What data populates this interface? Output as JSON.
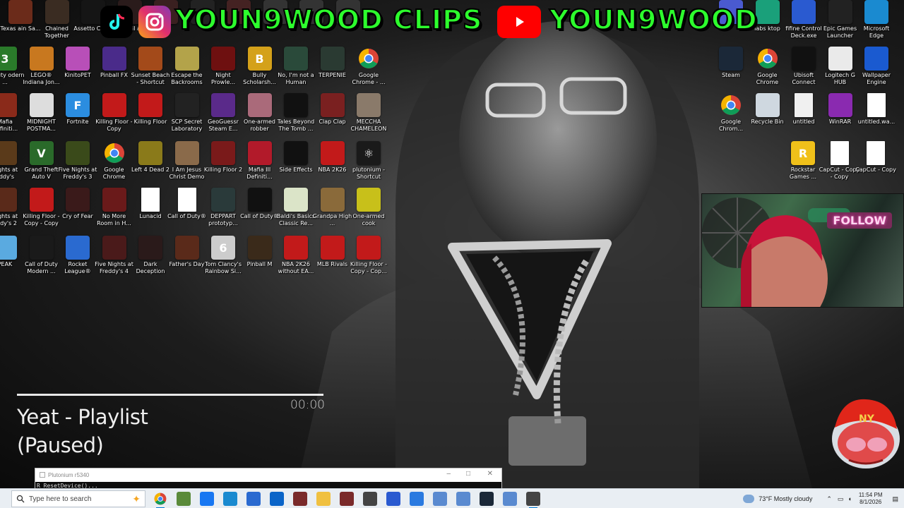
{
  "banner": {
    "text_left": "YOUN9WOOD CLIPS",
    "text_right": "YOUN9WOOD",
    "colors": {
      "text": "#2dff2d",
      "instagram": "#e1306c",
      "youtube": "#ff0000",
      "tiktok": "#000000"
    }
  },
  "desktop_left": [
    [
      {
        "label": "Texas\nain Sa...",
        "icon": "game-icon",
        "color": "#6b2b1a",
        "glyph": ""
      },
      {
        "label": "Chained Together",
        "icon": "game-icon",
        "color": "#3a2c22",
        "glyph": ""
      },
      {
        "label": "Assetto Corsa",
        "icon": "racing-icon",
        "color": "#151515",
        "glyph": ""
      },
      {
        "label": "ead Evil ard",
        "icon": "game-icon",
        "color": "#2a1b1b",
        "glyph": ""
      },
      {
        "label": "",
        "icon": "game-icon",
        "color": "#3a2020",
        "glyph": ""
      },
      {
        "label": "",
        "icon": "game-icon",
        "color": "#222",
        "glyph": ""
      },
      {
        "label": "",
        "icon": "game-icon",
        "color": "#442222",
        "glyph": ""
      },
      {
        "label": "",
        "icon": "game-icon",
        "color": "#333",
        "glyph": ""
      },
      {
        "label": "",
        "icon": "game-icon",
        "color": "#333",
        "glyph": ""
      },
      {
        "label": "",
        "icon": "game-icon",
        "color": "#333",
        "glyph": ""
      }
    ],
    [
      {
        "label": "of Duty odern ...",
        "icon": "game-icon",
        "color": "#2a7a2a",
        "glyph": "3"
      },
      {
        "label": "LEGO® Indiana Jon...",
        "icon": "game-icon",
        "color": "#c8781f",
        "glyph": ""
      },
      {
        "label": "KinitoPET",
        "icon": "pet-icon",
        "color": "#b84fb8",
        "glyph": ""
      },
      {
        "label": "Pinball FX",
        "icon": "pinball-icon",
        "color": "#4a2b8a",
        "glyph": ""
      },
      {
        "label": "Sunset Beach - Shortcut",
        "icon": "game-icon",
        "color": "#a34a1a",
        "glyph": ""
      },
      {
        "label": "Escape the Backrooms",
        "icon": "game-icon",
        "color": "#b3a34a",
        "glyph": ""
      },
      {
        "label": "Night Prowle...",
        "icon": "game-icon",
        "color": "#6e1010",
        "glyph": ""
      },
      {
        "label": "Bully Scholarsh...",
        "icon": "game-icon",
        "color": "#d4a11a",
        "glyph": "B"
      },
      {
        "label": "No, I'm not a Human",
        "icon": "game-icon",
        "color": "#2a4a3a",
        "glyph": ""
      },
      {
        "label": "TERPENIE",
        "icon": "game-icon",
        "color": "#2a3a32",
        "glyph": ""
      },
      {
        "label": "Google Chrome - ...",
        "icon": "chrome-icon",
        "color": "chrome",
        "glyph": ""
      }
    ],
    [
      {
        "label": "Mafia Definiti...",
        "icon": "game-icon",
        "color": "#8a2a1a",
        "glyph": ""
      },
      {
        "label": "MIDNIGHT POSTMA...",
        "icon": "game-icon",
        "color": "#dddddd",
        "glyph": ""
      },
      {
        "label": "Fortnite",
        "icon": "fortnite-icon",
        "color": "#2b8de0",
        "glyph": "F"
      },
      {
        "label": "Killing Floor - Copy",
        "icon": "game-icon",
        "color": "#c21a1a",
        "glyph": ""
      },
      {
        "label": "Killing Floor",
        "icon": "game-icon",
        "color": "#c21a1a",
        "glyph": ""
      },
      {
        "label": "SCP Secret Laboratory",
        "icon": "game-icon",
        "color": "#222",
        "glyph": ""
      },
      {
        "label": "GeoGuessr Steam E...",
        "icon": "map-pin-icon",
        "color": "#5a2a8a",
        "glyph": ""
      },
      {
        "label": "One-armed robber",
        "icon": "game-icon",
        "color": "#aa6a7a",
        "glyph": ""
      },
      {
        "label": "Tales Beyond The Tomb ...",
        "icon": "game-icon",
        "color": "#111",
        "glyph": ""
      },
      {
        "label": "Clap Clap",
        "icon": "game-icon",
        "color": "#7a2020",
        "glyph": ""
      },
      {
        "label": "MECCHA CHAMELEON",
        "icon": "game-icon",
        "color": "#8a7a6a",
        "glyph": ""
      }
    ],
    [
      {
        "label": "Nights at eddy's",
        "icon": "game-icon",
        "color": "#5a3a1a",
        "glyph": ""
      },
      {
        "label": "Grand Theft Auto V",
        "icon": "gta-icon",
        "color": "#2a6a2a",
        "glyph": "V"
      },
      {
        "label": "Five Nights at Freddy's 3",
        "icon": "game-icon",
        "color": "#3a4a1a",
        "glyph": ""
      },
      {
        "label": "Google Chrome",
        "icon": "chrome-icon",
        "color": "chrome",
        "glyph": ""
      },
      {
        "label": "Left 4 Dead 2",
        "icon": "game-icon",
        "color": "#8a7a1a",
        "glyph": ""
      },
      {
        "label": "I Am Jesus Christ Demo",
        "icon": "game-icon",
        "color": "#8a6a4a",
        "glyph": ""
      },
      {
        "label": "Killing Floor 2",
        "icon": "game-icon",
        "color": "#7a1a1a",
        "glyph": ""
      },
      {
        "label": "Mafia III Definiti...",
        "icon": "game-icon",
        "color": "#b21a2a",
        "glyph": ""
      },
      {
        "label": "Side Effects",
        "icon": "game-icon",
        "color": "#111",
        "glyph": ""
      },
      {
        "label": "NBA 2K26",
        "icon": "game-icon",
        "color": "#c21a1a",
        "glyph": ""
      },
      {
        "label": "plutonium - Shortcut",
        "icon": "atom-icon",
        "color": "#1a1a1a",
        "glyph": "⚛"
      }
    ],
    [
      {
        "label": "Nights at eddy's 2",
        "icon": "game-icon",
        "color": "#5a2a1a",
        "glyph": ""
      },
      {
        "label": "Killing Floor - Copy - Copy",
        "icon": "game-icon",
        "color": "#c21a1a",
        "glyph": ""
      },
      {
        "label": "Cry of Fear",
        "icon": "game-icon",
        "color": "#3a1a1a",
        "glyph": ""
      },
      {
        "label": "No More Room in H...",
        "icon": "game-icon",
        "color": "#6a1a1a",
        "glyph": ""
      },
      {
        "label": "Lunacid",
        "icon": "file-icon",
        "color": "#ffffff",
        "glyph": ""
      },
      {
        "label": "Call of Duty®",
        "icon": "file-icon",
        "color": "#ffffff",
        "glyph": ""
      },
      {
        "label": "DEPPART prototyp...",
        "icon": "game-icon",
        "color": "#2a3a3a",
        "glyph": ""
      },
      {
        "label": "Call of Duty®",
        "icon": "cod-icon",
        "color": "#111",
        "glyph": ""
      },
      {
        "label": "Baldi's Basics Classic Re...",
        "icon": "game-icon",
        "color": "#dbe4c8",
        "glyph": ""
      },
      {
        "label": "Grandpa High ...",
        "icon": "game-icon",
        "color": "#8a6a3a",
        "glyph": ""
      },
      {
        "label": "One-armed cook",
        "icon": "game-icon",
        "color": "#c8c01a",
        "glyph": ""
      }
    ],
    [
      {
        "label": "PEAK",
        "icon": "game-icon",
        "color": "#5aaae0",
        "glyph": ""
      },
      {
        "label": "Call of Duty Modern ...",
        "icon": "game-icon",
        "color": "#1a1a1a",
        "glyph": ""
      },
      {
        "label": "Rocket League®",
        "icon": "game-icon",
        "color": "#2a6ad0",
        "glyph": ""
      },
      {
        "label": "Five Nights at Freddy's 4",
        "icon": "game-icon",
        "color": "#4a1a1a",
        "glyph": ""
      },
      {
        "label": "Dark Deception",
        "icon": "game-icon",
        "color": "#2a1a1a",
        "glyph": ""
      },
      {
        "label": "Father's Day",
        "icon": "game-icon",
        "color": "#5a2a1a",
        "glyph": ""
      },
      {
        "label": "Tom Clancy's Rainbow Si...",
        "icon": "game-icon",
        "color": "#cccccc",
        "glyph": "6"
      },
      {
        "label": "Pinball M",
        "icon": "game-icon",
        "color": "#3a2a1a",
        "glyph": ""
      },
      {
        "label": "NBA 2K26 without EA...",
        "icon": "game-icon",
        "color": "#c21a1a",
        "glyph": ""
      },
      {
        "label": "MLB Rivals",
        "icon": "game-icon",
        "color": "#c21a1a",
        "glyph": ""
      },
      {
        "label": "Killing Floor - Copy - Cop...",
        "icon": "game-icon",
        "color": "#c21a1a",
        "glyph": ""
      }
    ]
  ],
  "desktop_right": [
    [
      {
        "label": "",
        "icon": "game-icon",
        "color": "#4a5ad0",
        "glyph": ""
      },
      {
        "label": "labs ktop",
        "icon": "app-icon",
        "color": "#1aa07a",
        "glyph": ""
      },
      {
        "label": "fifine Control Deck.exe",
        "icon": "app-icon",
        "color": "#2a5ad0",
        "glyph": ""
      },
      {
        "label": "Epic Games Launcher",
        "icon": "epic-icon",
        "color": "#222",
        "glyph": ""
      },
      {
        "label": "Microsoft Edge",
        "icon": "edge-icon",
        "color": "#1a8ad0",
        "glyph": ""
      }
    ],
    [
      {
        "label": "Steam",
        "icon": "steam-icon",
        "color": "#1b2838",
        "glyph": ""
      },
      {
        "label": "Google Chrome",
        "icon": "chrome-icon",
        "color": "chrome",
        "glyph": ""
      },
      {
        "label": "Ubisoft Connect",
        "icon": "ubisoft-icon",
        "color": "#111",
        "glyph": ""
      },
      {
        "label": "Logitech G HUB",
        "icon": "app-icon",
        "color": "#eaeaea",
        "glyph": ""
      },
      {
        "label": "Wallpaper Engine",
        "icon": "app-icon",
        "color": "#1a5ad0",
        "glyph": ""
      }
    ],
    [
      {
        "label": "Google Chrom...",
        "icon": "chrome-icon",
        "color": "chrome",
        "glyph": ""
      },
      {
        "label": "Recycle Bin",
        "icon": "recycle-bin-icon",
        "color": "#cfd8e0",
        "glyph": ""
      },
      {
        "label": "untitled",
        "icon": "media-icon",
        "color": "#f0f0f0",
        "glyph": ""
      },
      {
        "label": "WinRAR",
        "icon": "winrar-icon",
        "color": "#8a2ab0",
        "glyph": ""
      },
      {
        "label": "untitled.wa...",
        "icon": "file-icon",
        "color": "#ffffff",
        "glyph": ""
      }
    ],
    [
      {
        "label": "Rockstar Games ...",
        "icon": "rockstar-icon",
        "color": "#f0c01a",
        "glyph": "R"
      },
      {
        "label": "CapCut - Copy - Copy",
        "icon": "file-icon",
        "color": "#ffffff",
        "glyph": ""
      },
      {
        "label": "CapCut - Copy",
        "icon": "file-icon",
        "color": "#ffffff",
        "glyph": ""
      }
    ]
  ],
  "webcam": {
    "overlay_text": "FOLLOW"
  },
  "music": {
    "time": "00:00",
    "song": "Yeat - Playlist",
    "state": "(Paused)",
    "progress": 1.0
  },
  "console": {
    "title": "Plutonium r5340",
    "line": "R_ResetDevice()..."
  },
  "taskbar": {
    "search_placeholder": "Type here to search",
    "apps": [
      "chrome-icon",
      "minecraft-icon",
      "facebook-icon",
      "edge-icon",
      "store-icon",
      "outlook-icon",
      "game-icon",
      "file-explorer-icon",
      "game-icon",
      "app-icon",
      "terminal-icon",
      "shield-icon",
      "window-icon",
      "window-icon",
      "steam-icon",
      "window-icon",
      "app-icon"
    ],
    "weather": "73°F  Mostly cloudy",
    "time": "11:54 PM",
    "date": "8/1/2026"
  }
}
